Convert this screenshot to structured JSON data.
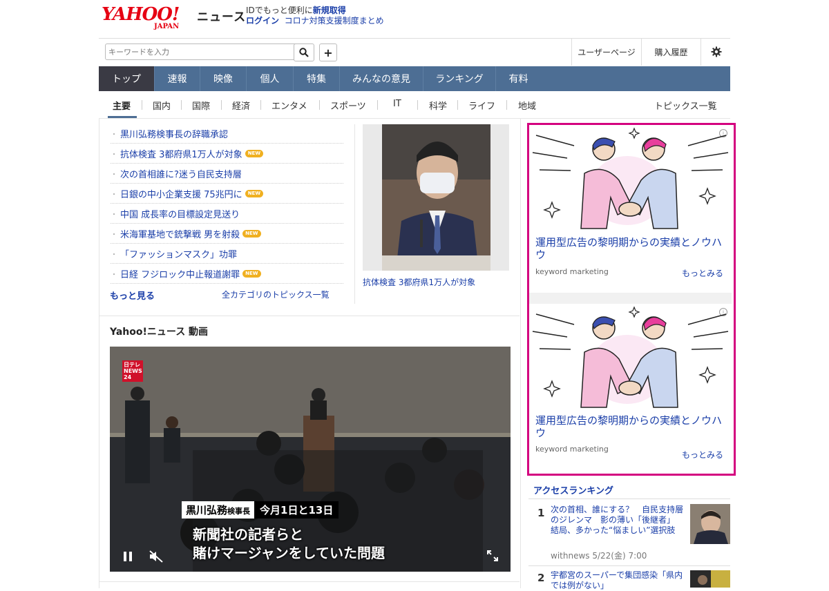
{
  "header": {
    "logo_text": "YAHOO!",
    "logo_sub": "JAPAN",
    "service": "ニュース",
    "id_prompt": "IDでもっと便利に",
    "signup": "新規取得",
    "login": "ログイン",
    "covid_link": "コロナ対策支援制度まとめ"
  },
  "search": {
    "placeholder": "キーワードを入力"
  },
  "utility": {
    "user_page": "ユーザーページ",
    "purchase_history": "購入履歴"
  },
  "nav": {
    "items": [
      {
        "label": "トップ"
      },
      {
        "label": "速報"
      },
      {
        "label": "映像"
      },
      {
        "label": "個人"
      },
      {
        "label": "特集"
      },
      {
        "label": "みんなの意見"
      },
      {
        "label": "ランキング"
      },
      {
        "label": "有料"
      }
    ]
  },
  "subnav": {
    "items": [
      {
        "label": "主要"
      },
      {
        "label": "国内"
      },
      {
        "label": "国際"
      },
      {
        "label": "経済"
      },
      {
        "label": "エンタメ"
      },
      {
        "label": "スポーツ"
      },
      {
        "label": "IT"
      },
      {
        "label": "科学"
      },
      {
        "label": "ライフ"
      },
      {
        "label": "地域"
      }
    ],
    "topics_list": "トピックス一覧"
  },
  "topics": {
    "items": [
      {
        "title": "黒川弘務検事長の辞職承認",
        "new": ""
      },
      {
        "title": "抗体検査 3都府県1万人が対象",
        "new": "NEW"
      },
      {
        "title": "次の首相誰に?迷う自民支持層",
        "new": ""
      },
      {
        "title": "日銀の中小企業支援 75兆円に",
        "new": "NEW"
      },
      {
        "title": "中国 成長率の目標設定見送り",
        "new": ""
      },
      {
        "title": "米海軍基地で銃撃戦 男を射殺",
        "new": "NEW"
      },
      {
        "title": "「ファッションマスク」功罪",
        "new": ""
      },
      {
        "title": "日経 フジロック中止報道謝罪",
        "new": "NEW"
      }
    ],
    "more": "もっと見る",
    "all_categories": "全カテゴリのトピックス一覧",
    "photo_caption": "抗体検査 3都府県1万人が対象"
  },
  "video": {
    "section_title": "Yahoo!ニュース 動画",
    "channel_logo": "日テレ NEWS 24",
    "caption_name": "黒川弘務",
    "caption_role": "検事長",
    "caption_date": "今月1日と13日",
    "caption_line1": "新聞社の記者らと",
    "caption_line2": "賭けマージャンをしていた問題"
  },
  "ads": [
    {
      "text": "運用型広告の黎明期からの実績とノウハウ",
      "brand": "keyword marketing",
      "more": "もっとみる"
    },
    {
      "text": "運用型広告の黎明期からの実績とノウハウ",
      "brand": "keyword marketing",
      "more": "もっとみる"
    }
  ],
  "ranking": {
    "title": "アクセスランキング",
    "items": [
      {
        "rank": "1",
        "title": "次の首相、誰にする？　自民支持層のジレンマ　影の薄い「後継者」　結局、多かった“悩ましい”選択肢",
        "source": "withnews 5/22(金) 7:00"
      },
      {
        "rank": "2",
        "title": "宇都宮のスーパーで集団感染「県内では例がない」",
        "source": ""
      }
    ]
  },
  "colors": {
    "nav_bg": "#4d6e94",
    "link": "#1a3ea8",
    "ad_border": "#d4007f",
    "logo_red": "#e60012"
  }
}
